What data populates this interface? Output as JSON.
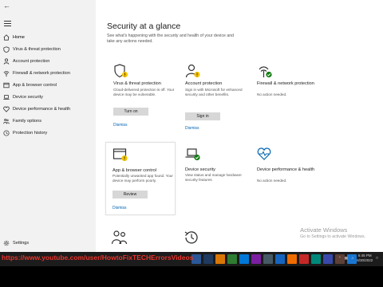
{
  "sidebar": {
    "back_icon": "back-arrow-icon",
    "menu_icon": "hamburger-icon",
    "items": [
      {
        "label": "Home",
        "icon": "home-icon",
        "active": true
      },
      {
        "label": "Virus & threat protection",
        "icon": "shield-icon"
      },
      {
        "label": "Account protection",
        "icon": "person-icon"
      },
      {
        "label": "Firewall & network protection",
        "icon": "wifi-icon"
      },
      {
        "label": "App & browser control",
        "icon": "app-window-icon"
      },
      {
        "label": "Device security",
        "icon": "laptop-icon"
      },
      {
        "label": "Device performance & health",
        "icon": "heart-icon"
      },
      {
        "label": "Family options",
        "icon": "family-icon"
      },
      {
        "label": "Protection history",
        "icon": "history-icon"
      }
    ],
    "settings_label": "Settings"
  },
  "main": {
    "title": "Security at a glance",
    "subtitle": "See what's happening with the security and health of your device and take any actions needed.",
    "cards": [
      {
        "title": "Virus & threat protection",
        "desc": "Cloud-delivered protection is off. Your device may be vulnerable.",
        "button": "Turn on",
        "link": "Dismiss",
        "icon": "shield-warning-icon"
      },
      {
        "title": "Account protection",
        "desc": "Sign in with Microsoft for enhanced security and other benefits.",
        "button": "Sign in",
        "link": "Dismiss",
        "icon": "person-warning-icon"
      },
      {
        "title": "Firewall & network protection",
        "desc": "No action needed.",
        "icon": "wifi-check-icon"
      },
      {
        "title": "App & browser control",
        "desc": "Potentially unwanted app found. Your device may perform poorly.",
        "button": "Review",
        "link": "Dismiss",
        "icon": "app-warning-icon"
      },
      {
        "title": "Device security",
        "desc": "View status and manage hardware security features",
        "icon": "laptop-check-icon"
      },
      {
        "title": "Device performance & health",
        "desc": "No action needed.",
        "icon": "heart-pulse-icon"
      }
    ]
  },
  "watermark": {
    "line1": "Activate Windows",
    "line2": "Go to Settings to activate Windows."
  },
  "taskbar": {
    "time": "6:45 PM",
    "date": "6/30/2022",
    "overlay_url": "https://www.youtube.com/user/HowtoFixTECHErrorsVideos"
  },
  "colors": {
    "accent": "#0063b1",
    "warning": "#f5c400",
    "ok": "#107c10",
    "overlay": "#e8342c"
  }
}
